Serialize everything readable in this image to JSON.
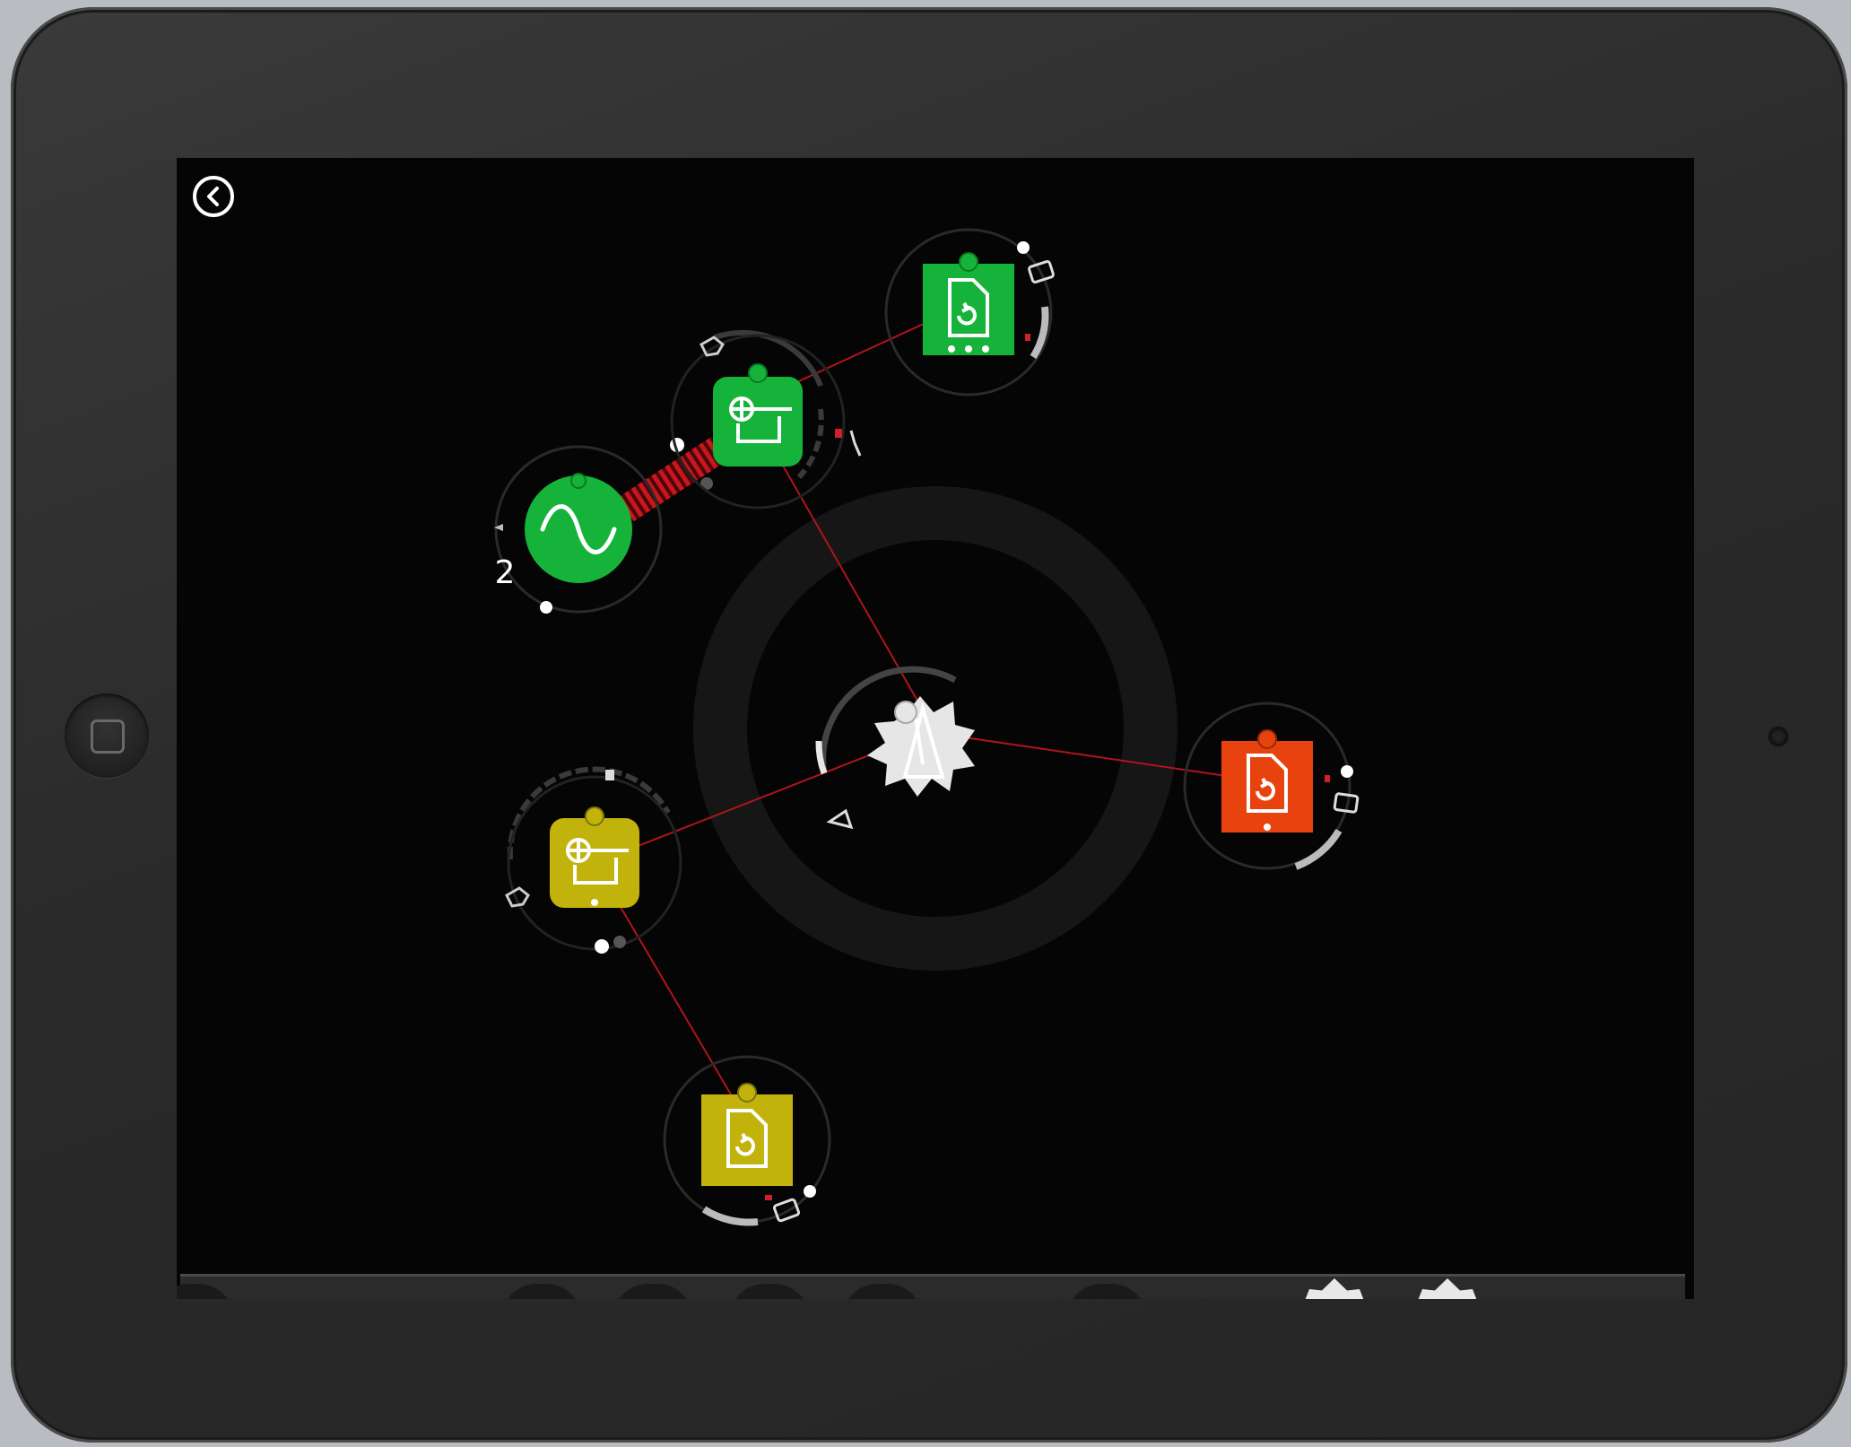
{
  "app": {
    "back_label": "",
    "colors": {
      "green": "#16b33a",
      "yellow": "#c1b20c",
      "orange": "#e8420e",
      "connection": "#b0141c",
      "hub": "#e6e6e6"
    }
  },
  "nodes": [
    {
      "id": "oscillator",
      "icon": "sine-wave-icon",
      "color": "green",
      "shape": "circle",
      "value": "2"
    },
    {
      "id": "filter-green",
      "icon": "filter-icon",
      "color": "green",
      "shape": "rounded-square"
    },
    {
      "id": "sample-player-green",
      "icon": "sample-file-icon",
      "color": "green",
      "shape": "square"
    },
    {
      "id": "master-hub",
      "icon": "metronome-icon",
      "color": "hub",
      "shape": "gear"
    },
    {
      "id": "sample-player-orange",
      "icon": "sample-file-icon",
      "color": "orange",
      "shape": "square"
    },
    {
      "id": "filter-yellow",
      "icon": "filter-icon",
      "color": "yellow",
      "shape": "rounded-square"
    },
    {
      "id": "sample-player-yellow",
      "icon": "sample-file-icon",
      "color": "yellow",
      "shape": "square"
    }
  ],
  "bottom_tray": {
    "items": [
      "tray-slot",
      "tray-slot",
      "tray-slot",
      "tray-slot",
      "tray-slot",
      "tray-gear",
      "tray-gear"
    ]
  }
}
